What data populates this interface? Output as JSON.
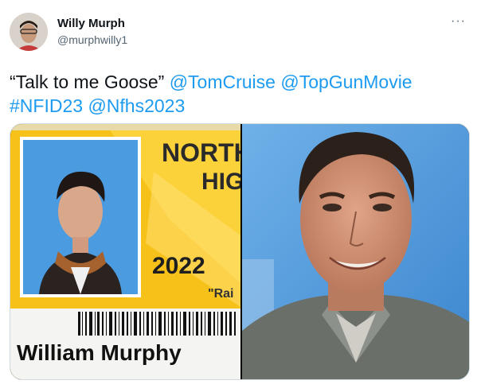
{
  "author": {
    "display_name": "Willy Murph",
    "handle": "@murphwilly1"
  },
  "menu_icon": "more-horizontal-icon",
  "tweet": {
    "quote": "“Talk to me Goose”",
    "links_line1": [
      "@TomCruise",
      "@TopGunMovie"
    ],
    "links_line2": [
      "#NFID23",
      "@Nfhs2023"
    ]
  },
  "media": {
    "id_card": {
      "school_line1": "NORTH",
      "school_line2": "HIG",
      "year": "2022",
      "quote_fragment": "\"Rai",
      "student_name": "William Murphy"
    }
  },
  "colors": {
    "link": "#1d9bf0",
    "card_yellow": "#f6c21a",
    "photo_blue": "#4a9be0"
  }
}
